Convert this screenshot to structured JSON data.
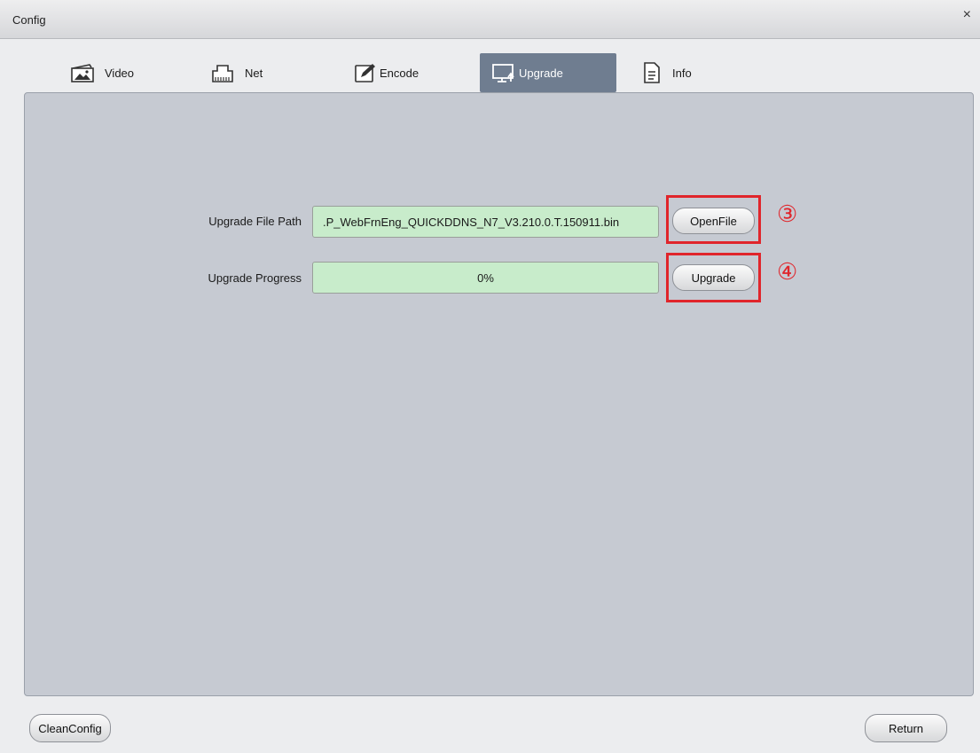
{
  "window": {
    "title": "Config",
    "close_glyph": "×"
  },
  "tabs": [
    {
      "label": "Video",
      "icon": "video-icon",
      "active": false
    },
    {
      "label": "Net",
      "icon": "net-icon",
      "active": false
    },
    {
      "label": "Encode",
      "icon": "encode-icon",
      "active": false
    },
    {
      "label": "Upgrade",
      "icon": "upgrade-icon",
      "active": true
    },
    {
      "label": "Info",
      "icon": "info-icon",
      "active": false
    }
  ],
  "upgrade": {
    "file_path_label": "Upgrade File Path",
    "file_path_value": ".P_WebFrnEng_QUICKDDNS_N7_V3.210.0.T.150911.bin",
    "open_file_label": "OpenFile",
    "progress_label": "Upgrade Progress",
    "progress_text": "0%",
    "progress_value": 0,
    "upgrade_button_label": "Upgrade",
    "annotation_3": "③",
    "annotation_4": "④"
  },
  "footer": {
    "clean_config_label": "CleanConfig",
    "return_label": "Return"
  },
  "colors": {
    "accent_tab": "#6f7d90",
    "field_green": "#c8eccb",
    "annotation_red": "#e0252b"
  }
}
